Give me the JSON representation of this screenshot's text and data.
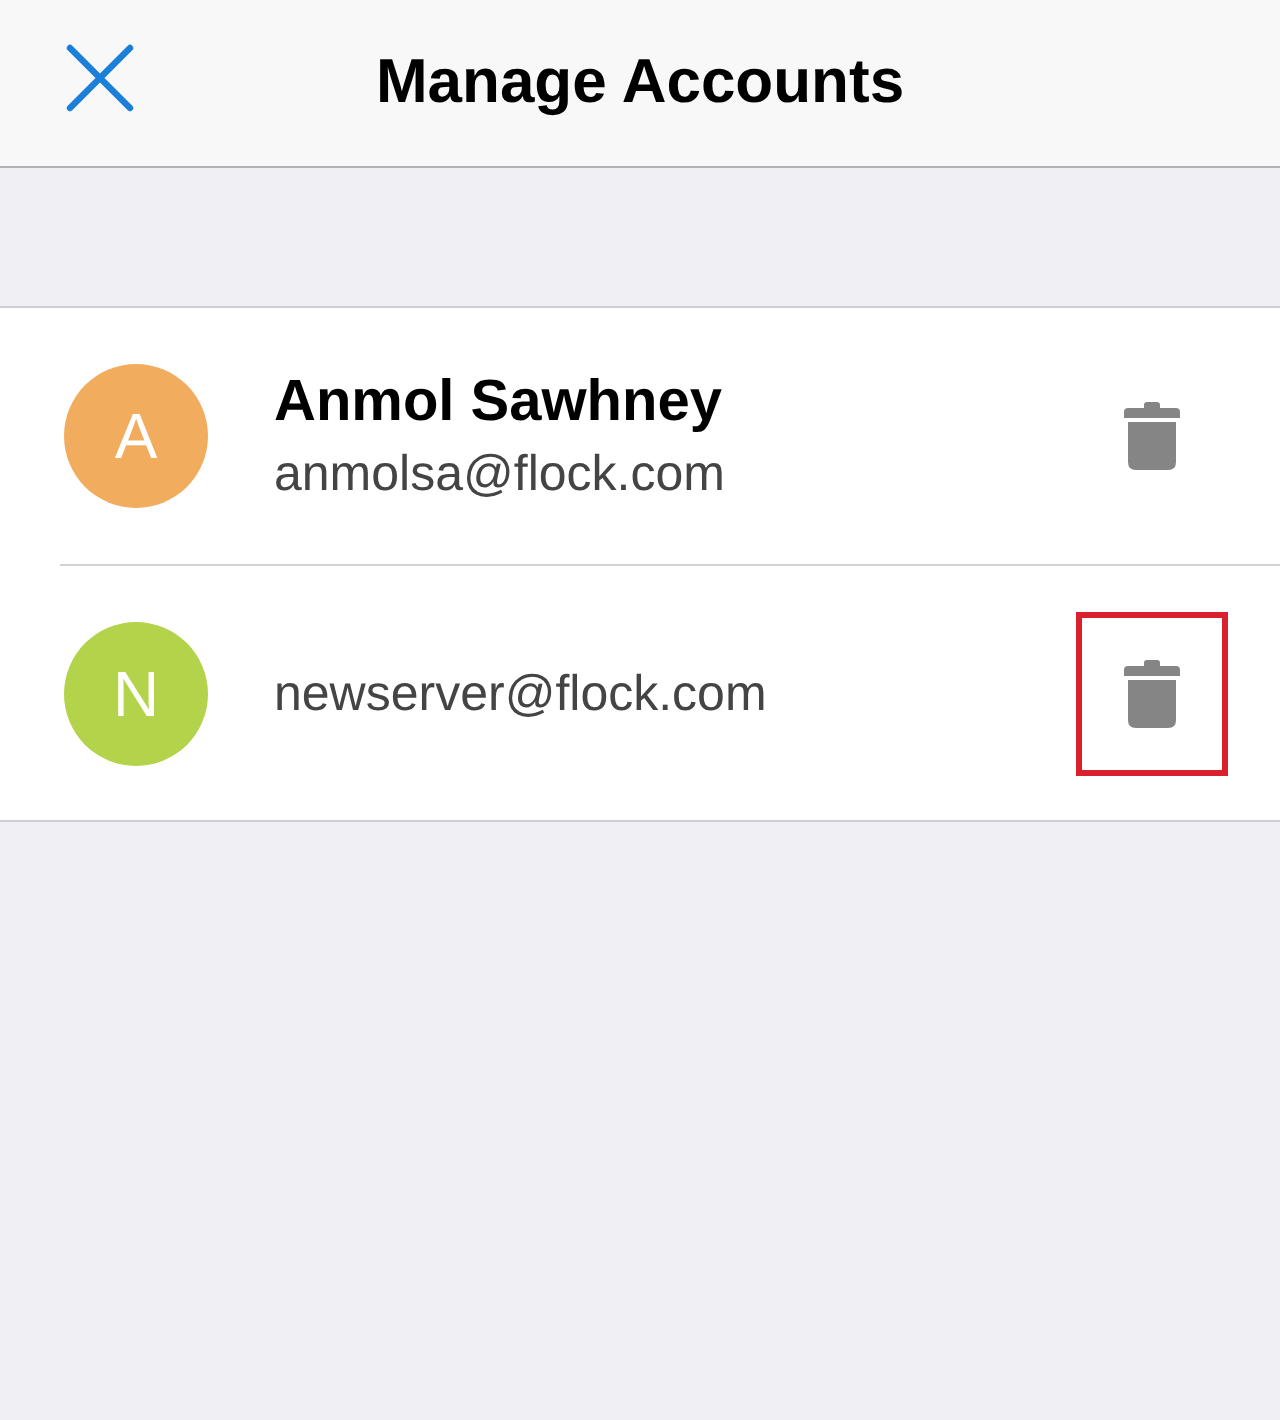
{
  "header": {
    "title": "Manage Accounts"
  },
  "accounts": [
    {
      "initial": "A",
      "color": "#f2ac5d",
      "name": "Anmol Sawhney",
      "email": "anmolsa@flock.com",
      "highlighted": false
    },
    {
      "initial": "N",
      "color": "#b3d34a",
      "email": "newserver@flock.com",
      "highlighted": true
    }
  ]
}
